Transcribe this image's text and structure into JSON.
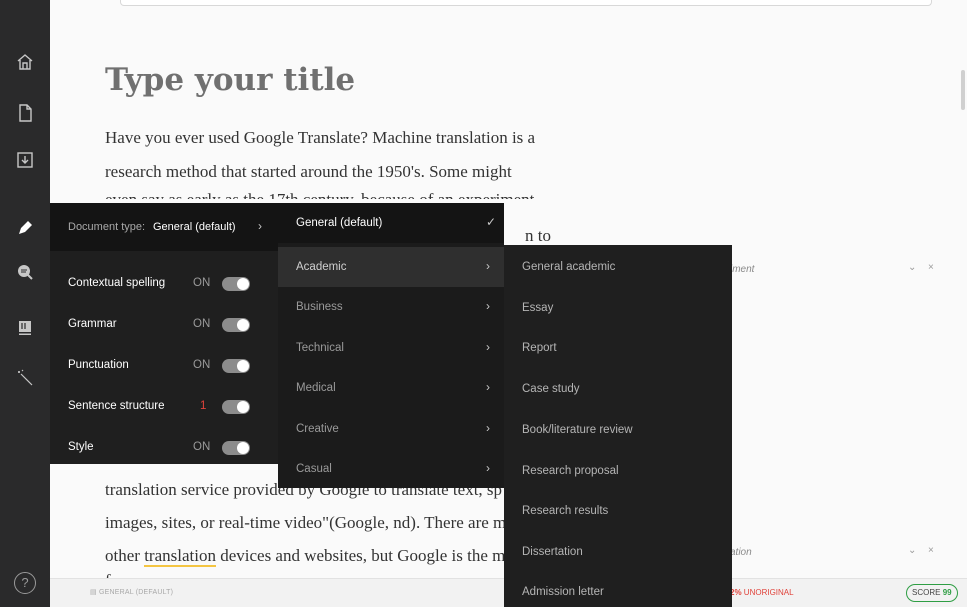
{
  "editor": {
    "title": "Type your title",
    "paragraph_lines": [
      "Have you ever used Google Translate? Machine translation is a",
      "research method that started around the 1950's. Some might",
      "even say as early as the 17th century, because of an experiment",
      "",
      "translation service provided by Google to translate text, sp",
      "images, sites, or real-time video\"(Google, nd). There are ma",
      "other translation devices and websites, but Google is the m",
      "fa ... ... ..."
    ],
    "hidden_tail": "n to",
    "underlined_word": "translation"
  },
  "right_panel": {
    "card1_label": "iment",
    "card2_label": "ation",
    "expand_glyph": "⌄",
    "close_glyph": "×"
  },
  "status_bar": {
    "doc_type": "GENERAL (DEFAULT)",
    "unoriginal_percent": "2%",
    "unoriginal_label": "UNORIGINAL",
    "score_label": "SCORE",
    "score_value": "99"
  },
  "settings_panel": {
    "doc_type_label": "Document type:",
    "doc_type_value": "General (default)",
    "items": [
      {
        "name": "Contextual spelling",
        "state": "ON"
      },
      {
        "name": "Grammar",
        "state": "ON"
      },
      {
        "name": "Punctuation",
        "state": "ON"
      },
      {
        "name": "Sentence structure",
        "state": "1"
      },
      {
        "name": "Style",
        "state": "ON"
      }
    ]
  },
  "document_types": [
    {
      "label": "General (default)",
      "mark": "✓"
    },
    {
      "label": "Academic",
      "mark": "›"
    },
    {
      "label": "Business",
      "mark": "›"
    },
    {
      "label": "Technical",
      "mark": "›"
    },
    {
      "label": "Medical",
      "mark": "›"
    },
    {
      "label": "Creative",
      "mark": "›"
    },
    {
      "label": "Casual",
      "mark": "›"
    }
  ],
  "academic_types": [
    "General academic",
    "Essay",
    "Report",
    "Case study",
    "Book/literature review",
    "Research proposal",
    "Research results",
    "Dissertation",
    "Admission letter"
  ],
  "rail_icons": [
    "home-icon",
    "new-document-icon",
    "download-icon",
    "pen-icon",
    "search-document-icon",
    "book-icon",
    "magic-wand-icon",
    "help-icon"
  ],
  "help_glyph": "?",
  "colors": {
    "alert": "#e0433b",
    "score": "#2f9e44",
    "panel": "#1f1f1f"
  }
}
